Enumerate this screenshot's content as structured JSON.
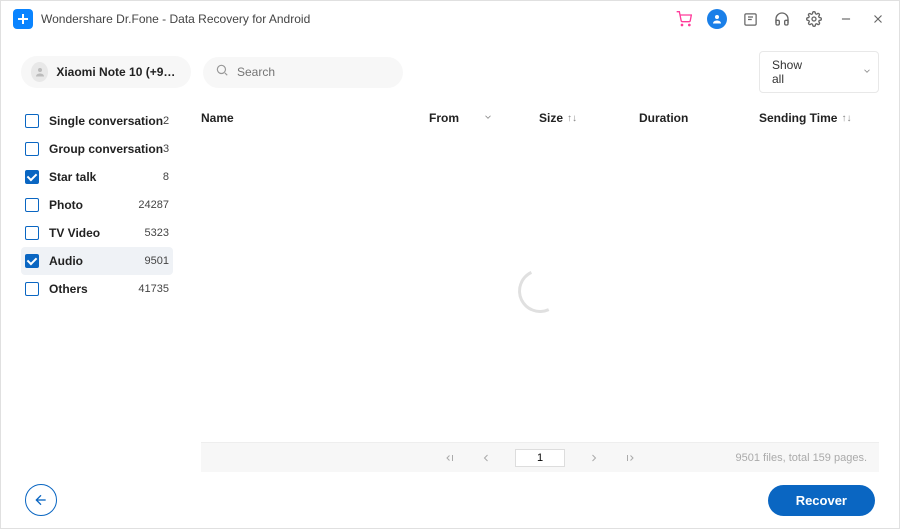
{
  "app_title": "Wondershare Dr.Fone - Data Recovery for Android",
  "device_name": "Xiaomi  Note 10 (+92315...",
  "search_placeholder": "Search",
  "filter": {
    "selected": "Show all"
  },
  "sidebar": {
    "items": [
      {
        "label": "Single conversation",
        "count": "2",
        "checked": false,
        "selected": false
      },
      {
        "label": "Group conversation",
        "count": "3",
        "checked": false,
        "selected": false
      },
      {
        "label": "Star talk",
        "count": "8",
        "checked": true,
        "selected": false
      },
      {
        "label": "Photo",
        "count": "24287",
        "checked": false,
        "selected": false
      },
      {
        "label": "TV Video",
        "count": "5323",
        "checked": false,
        "selected": false
      },
      {
        "label": "Audio",
        "count": "9501",
        "checked": true,
        "selected": true
      },
      {
        "label": "Others",
        "count": "41735",
        "checked": false,
        "selected": false
      }
    ]
  },
  "columns": {
    "name": "Name",
    "from": "From",
    "size": "Size",
    "duration": "Duration",
    "sending": "Sending Time"
  },
  "pagination": {
    "current": "1",
    "status": "9501 files, total 159 pages."
  },
  "buttons": {
    "recover": "Recover"
  }
}
